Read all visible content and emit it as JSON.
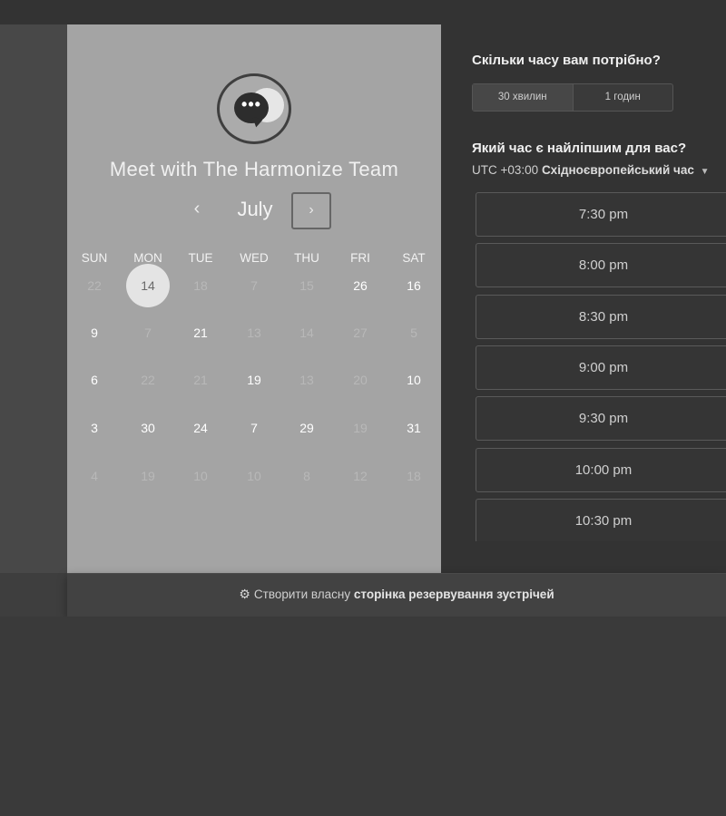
{
  "host": {
    "title": "Meet with The Harmonize Team"
  },
  "calendar": {
    "month": "July",
    "prev_symbol": "‹",
    "next_symbol": "›",
    "weekdays": [
      "SUN",
      "MON",
      "TUE",
      "WED",
      "THU",
      "FRI",
      "SAT"
    ],
    "weeks": [
      [
        {
          "d": "22",
          "s": "dim"
        },
        {
          "d": "14",
          "s": "selected"
        },
        {
          "d": "18",
          "s": "dim"
        },
        {
          "d": "7",
          "s": "dim"
        },
        {
          "d": "15",
          "s": "dim"
        },
        {
          "d": "26",
          "s": "active"
        },
        {
          "d": "16",
          "s": "active"
        }
      ],
      [
        {
          "d": "9",
          "s": "active"
        },
        {
          "d": "7",
          "s": "dim"
        },
        {
          "d": "21",
          "s": "active"
        },
        {
          "d": "13",
          "s": "dim"
        },
        {
          "d": "14",
          "s": "dim"
        },
        {
          "d": "27",
          "s": "dim"
        },
        {
          "d": "5",
          "s": "dim"
        }
      ],
      [
        {
          "d": "6",
          "s": "active"
        },
        {
          "d": "22",
          "s": "dim"
        },
        {
          "d": "21",
          "s": "dim"
        },
        {
          "d": "19",
          "s": "active"
        },
        {
          "d": "13",
          "s": "dim"
        },
        {
          "d": "20",
          "s": "dim"
        },
        {
          "d": "10",
          "s": "active"
        }
      ],
      [
        {
          "d": "3",
          "s": "active"
        },
        {
          "d": "30",
          "s": "active"
        },
        {
          "d": "24",
          "s": "active"
        },
        {
          "d": "7",
          "s": "active"
        },
        {
          "d": "29",
          "s": "active"
        },
        {
          "d": "19",
          "s": "dim"
        },
        {
          "d": "31",
          "s": "active"
        }
      ],
      [
        {
          "d": "4",
          "s": "dim"
        },
        {
          "d": "19",
          "s": "dim"
        },
        {
          "d": "10",
          "s": "dim"
        },
        {
          "d": "10",
          "s": "dim"
        },
        {
          "d": "8",
          "s": "dim"
        },
        {
          "d": "12",
          "s": "dim"
        },
        {
          "d": "18",
          "s": "dim"
        }
      ]
    ]
  },
  "duration": {
    "question": "Скільки часу вам потрібно?",
    "options": [
      "30 хвилин",
      "1 годин"
    ],
    "selected_index": 0
  },
  "time": {
    "question": "Який час є найліпшим для вас?",
    "tz_offset": "UTC +03:00",
    "tz_name": "Східноєвропейський час",
    "slots": [
      "7:30 pm",
      "8:00 pm",
      "8:30 pm",
      "9:00 pm",
      "9:30 pm",
      "10:00 pm",
      "10:30 pm"
    ]
  },
  "footer": {
    "prefix": "Створити власну",
    "link": "сторінка резервування зустрічей"
  }
}
